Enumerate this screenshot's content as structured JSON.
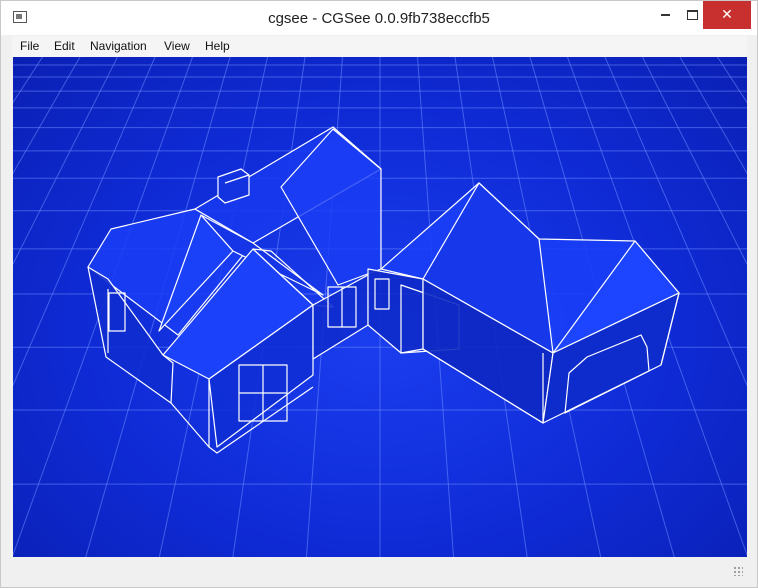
{
  "window": {
    "title": "cgsee - CGSee 0.0.9fb738eccfb5",
    "controls": {
      "minimize": "",
      "maximize": "",
      "close": "✕"
    }
  },
  "menu": {
    "items": [
      "File",
      "Edit",
      "Navigation",
      "View",
      "Help"
    ]
  },
  "viewport": {
    "content": "3D wireframe house model on blueprint grid",
    "background_color": "#1233e0",
    "line_color": "#ffffff"
  },
  "statusbar": {
    "text": ""
  }
}
